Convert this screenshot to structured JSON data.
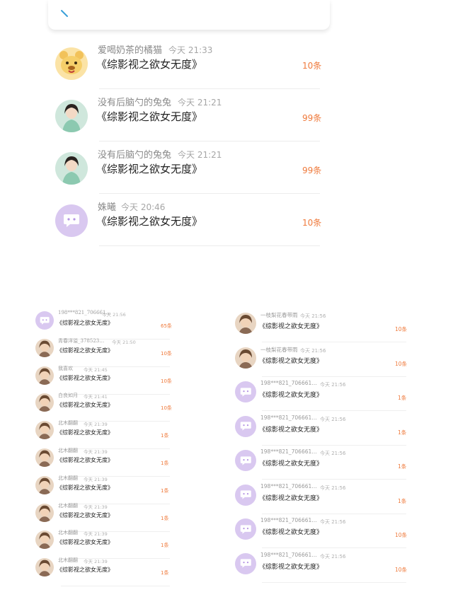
{
  "colors": {
    "accent": "#ef7a3c",
    "bubble_bg": "#d9c8f0",
    "bubble_icon": "#b493e3"
  },
  "book_title": "《综影视之欲女无度》",
  "big_list": [
    {
      "name": "爱喝奶茶的橘猫",
      "time": "今天 21:33",
      "count": "10条",
      "avatar": "bear-avatar"
    },
    {
      "name": "没有后脑勺的兔兔",
      "time": "今天 21:21",
      "count": "99条",
      "avatar": "girl-avatar"
    },
    {
      "name": "没有后脑勺的兔兔",
      "time": "今天 21:21",
      "count": "99条",
      "avatar": "girl-avatar"
    },
    {
      "name": "姝曦",
      "time": "今天 20:46",
      "count": "10条",
      "avatar": "chat-bubble-avatar"
    }
  ],
  "left_list": [
    {
      "name": "198***821_706661…",
      "time": "今天 21:56",
      "count": "65条",
      "avatar": "chat-bubble-avatar"
    },
    {
      "name": "青春洋溢_378523…",
      "time": "今天 21:50",
      "count": "10条",
      "avatar": "photo-avatar"
    },
    {
      "name": "我喜欢",
      "time": "今天 21:45",
      "count": "10条",
      "avatar": "photo-avatar"
    },
    {
      "name": "白良如月",
      "time": "今天 21:41",
      "count": "10条",
      "avatar": "photo-avatar"
    },
    {
      "name": "北木翻翻",
      "time": "今天 21:39",
      "count": "1条",
      "avatar": "photo-avatar"
    },
    {
      "name": "北木翻翻",
      "time": "今天 21:39",
      "count": "1条",
      "avatar": "photo-avatar"
    },
    {
      "name": "北木翻翻",
      "time": "今天 21:39",
      "count": "1条",
      "avatar": "photo-avatar"
    },
    {
      "name": "北木翻翻",
      "time": "今天 21:39",
      "count": "1条",
      "avatar": "photo-avatar"
    },
    {
      "name": "北木翻翻",
      "time": "今天 21:39",
      "count": "1条",
      "avatar": "photo-avatar"
    },
    {
      "name": "北木翻翻",
      "time": "今天 21:39",
      "count": "1条",
      "avatar": "photo-avatar"
    }
  ],
  "right_list": [
    {
      "name": "一枝梨花春带雨",
      "time": "今天 21:56",
      "count": "10条",
      "avatar": "photo-avatar"
    },
    {
      "name": "一枝梨花春带雨",
      "time": "今天 21:56",
      "count": "10条",
      "avatar": "photo-avatar"
    },
    {
      "name": "198***821_706661…",
      "time": "今天 21:56",
      "count": "1条",
      "avatar": "chat-bubble-avatar"
    },
    {
      "name": "198***821_706661…",
      "time": "今天 21:56",
      "count": "1条",
      "avatar": "chat-bubble-avatar"
    },
    {
      "name": "198***821_706661…",
      "time": "今天 21:56",
      "count": "1条",
      "avatar": "chat-bubble-avatar"
    },
    {
      "name": "198***821_706661…",
      "time": "今天 21:56",
      "count": "1条",
      "avatar": "chat-bubble-avatar"
    },
    {
      "name": "198***821_706661…",
      "time": "今天 21:56",
      "count": "10条",
      "avatar": "chat-bubble-avatar"
    },
    {
      "name": "198***821_706661…",
      "time": "今天 21:56",
      "count": "10条",
      "avatar": "chat-bubble-avatar"
    }
  ]
}
